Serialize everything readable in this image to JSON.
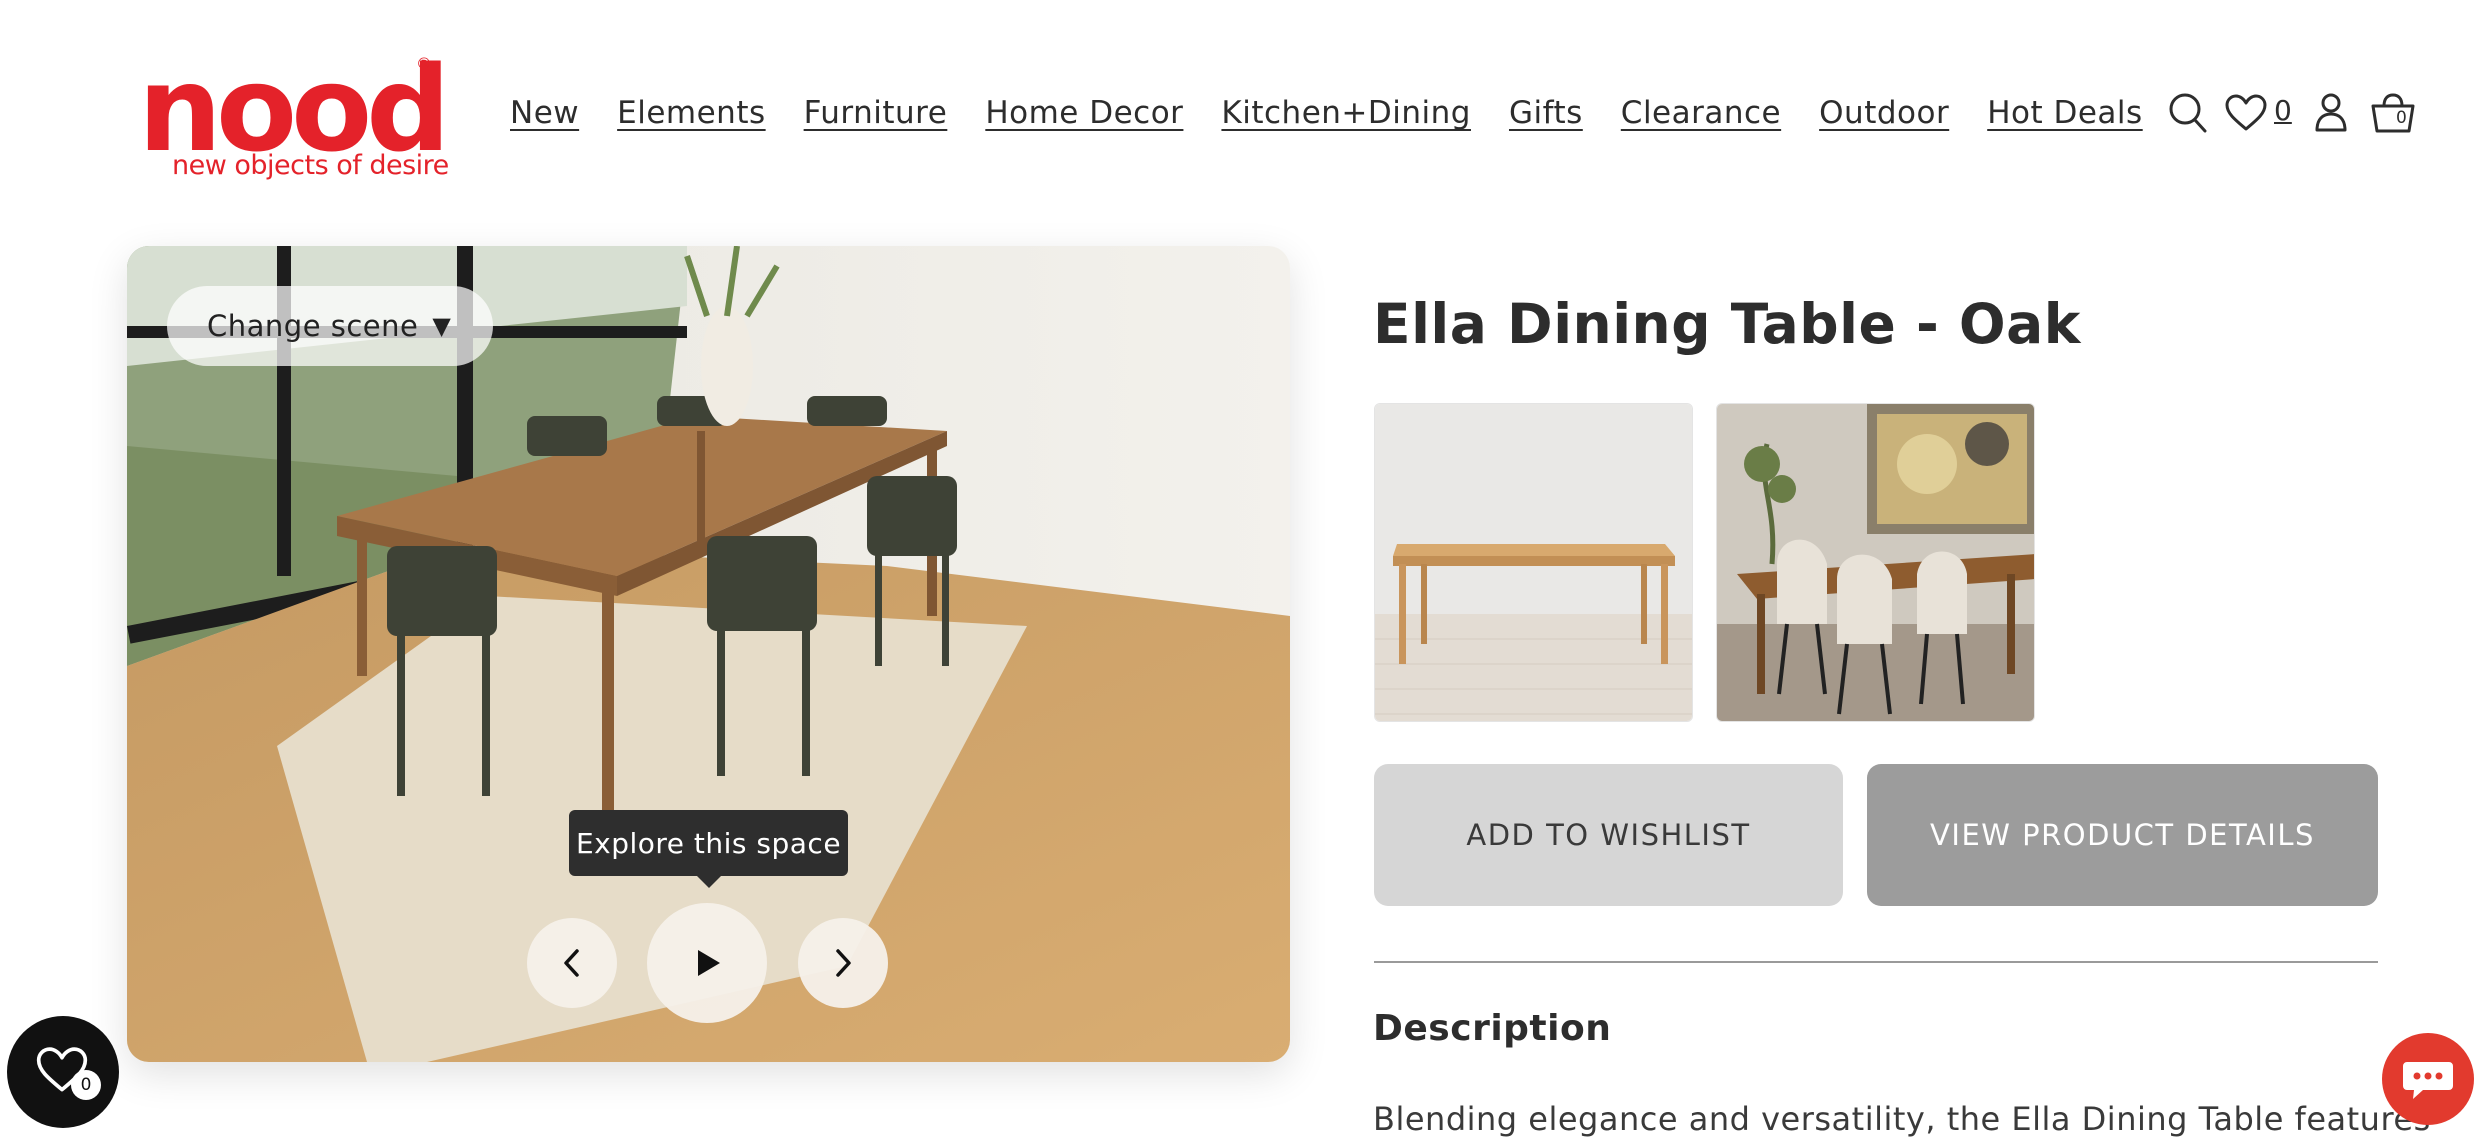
{
  "brand": {
    "logo_text": "nood",
    "registered": "®",
    "tagline": "new objects of desire",
    "color": "#e4222a"
  },
  "nav": {
    "items": [
      {
        "label": "New"
      },
      {
        "label": "Elements"
      },
      {
        "label": "Furniture"
      },
      {
        "label": "Home Decor"
      },
      {
        "label": "Kitchen+Dining"
      },
      {
        "label": "Gifts"
      },
      {
        "label": "Clearance"
      },
      {
        "label": "Outdoor"
      },
      {
        "label": "Hot Deals"
      }
    ]
  },
  "header_icons": {
    "search": "search-icon",
    "wishlist": "heart-icon",
    "wishlist_count": "0",
    "account": "user-icon",
    "cart": "basket-icon",
    "cart_count": "0"
  },
  "viewer": {
    "change_scene_label": "Change scene",
    "change_scene_caret": "▼",
    "tooltip": "Explore this space",
    "prev_icon": "chevron-left-icon",
    "play_icon": "play-icon",
    "next_icon": "chevron-right-icon"
  },
  "product": {
    "title": "Ella Dining Table - Oak",
    "thumbnails": [
      {
        "alt": "table-product-shot"
      },
      {
        "alt": "table-lifestyle-shot"
      }
    ],
    "add_to_wishlist": "ADD TO WISHLIST",
    "view_details": "VIEW PRODUCT DETAILS",
    "description_heading": "Description",
    "description_text": "Blending elegance and versatility, the Ella Dining Table features"
  },
  "floating": {
    "wishlist_badge": "0",
    "chat_icon": "chat-icon",
    "chat_color": "#e23a2e"
  }
}
